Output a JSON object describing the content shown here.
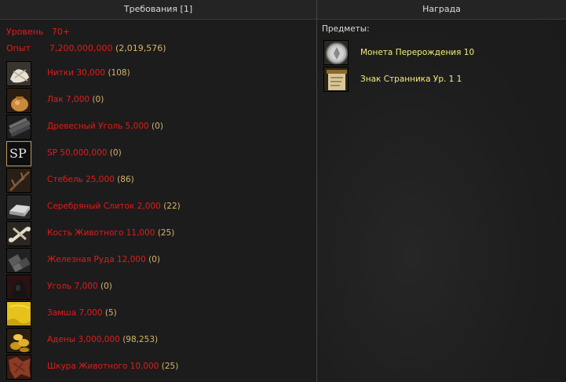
{
  "header": {
    "left_title": "Требования [1]",
    "right_title": "Награда"
  },
  "requirements": {
    "level_label": "Уровень",
    "level_value": "70+",
    "exp_label": "Опыт",
    "exp_value": "7,200,000,000",
    "exp_count": "(2,019,576)",
    "items": [
      {
        "name": "Нитки 30,000",
        "count": "(108)",
        "icon": "thread-icon"
      },
      {
        "name": "Лак 7,000",
        "count": "(0)",
        "icon": "varnish-bag-icon"
      },
      {
        "name": "Древесный Уголь 5,000",
        "count": "(0)",
        "icon": "charcoal-icon"
      },
      {
        "name": "SP 50,000,000",
        "count": "(0)",
        "icon": "sp-icon"
      },
      {
        "name": "Стебель 25,000",
        "count": "(86)",
        "icon": "stem-icon"
      },
      {
        "name": "Серебряный Слиток 2,000",
        "count": "(22)",
        "icon": "silver-ingot-icon"
      },
      {
        "name": "Кость Животного 11,000",
        "count": "(25)",
        "icon": "animal-bone-icon"
      },
      {
        "name": "Железная Руда 12,000",
        "count": "(0)",
        "icon": "iron-ore-icon"
      },
      {
        "name": "Уголь 7,000",
        "count": "(0)",
        "icon": "coal-icon"
      },
      {
        "name": "Замша 7,000",
        "count": "(5)",
        "icon": "suede-icon"
      },
      {
        "name": "Адены 3,000,000",
        "count": "(98,253)",
        "icon": "adena-coins-icon"
      },
      {
        "name": "Шкура Животного 10,000",
        "count": "(25)",
        "icon": "animal-skin-icon"
      }
    ]
  },
  "reward": {
    "items_title": "Предметы:",
    "items": [
      {
        "name": "Монета Перерождения 10",
        "icon": "rebirth-coin-icon"
      },
      {
        "name": "Знак Странника Ур. 1 1",
        "icon": "wanderer-sign-icon"
      }
    ]
  },
  "colors": {
    "requirement_red": "#e31b1b",
    "count_gold": "#d7b46a",
    "reward_yellow": "#f2ee7a"
  }
}
